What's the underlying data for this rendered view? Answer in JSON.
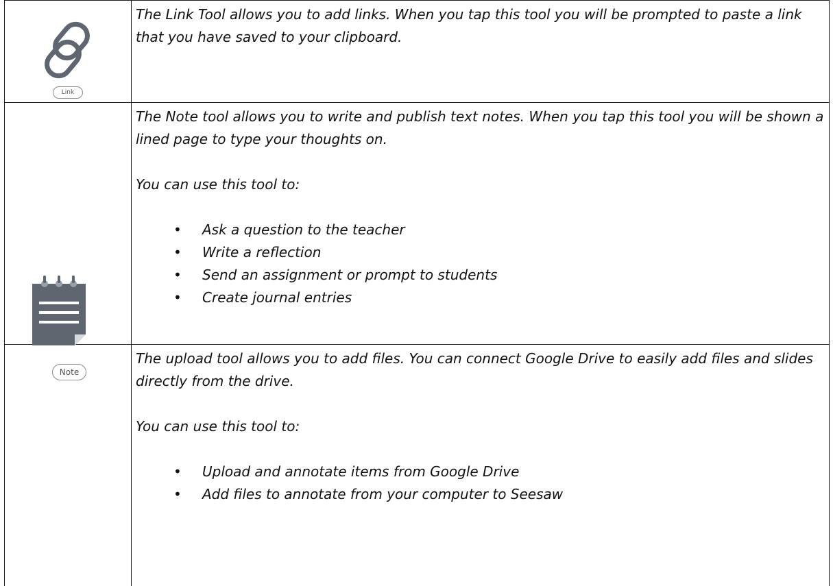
{
  "rows": [
    {
      "tool": "Link",
      "icon": "link-icon",
      "pill_label": "Link",
      "paragraphs": [
        "The Link Tool allows you to add links. When you tap this tool you will be prompted to paste a link that you have saved to your clipboard."
      ]
    },
    {
      "tool": "Note",
      "icon": "notepad-icon",
      "pill_label": "Note",
      "paragraphs": [
        "The Note tool allows you to write and publish text notes. When you tap this tool you will be shown a lined page to type your thoughts on.",
        "You can use this tool to:"
      ],
      "bullets": [
        "Ask a question to the teacher",
        "Write a reflection",
        "Send an assignment or prompt to students",
        "Create journal entries"
      ]
    },
    {
      "tool": "Upload",
      "paragraphs": [
        "The upload tool allows you to add files. You can connect Google Drive to easily add files and slides directly from the drive.",
        "You can use this tool to:"
      ],
      "bullets": [
        "Upload and annotate items from Google Drive",
        "Add files to annotate from your computer to Seesaw"
      ]
    }
  ],
  "bullet_glyph": "•",
  "colors": {
    "border": "#1a1a1a",
    "icon": "#5f6670",
    "text": "#111111"
  }
}
